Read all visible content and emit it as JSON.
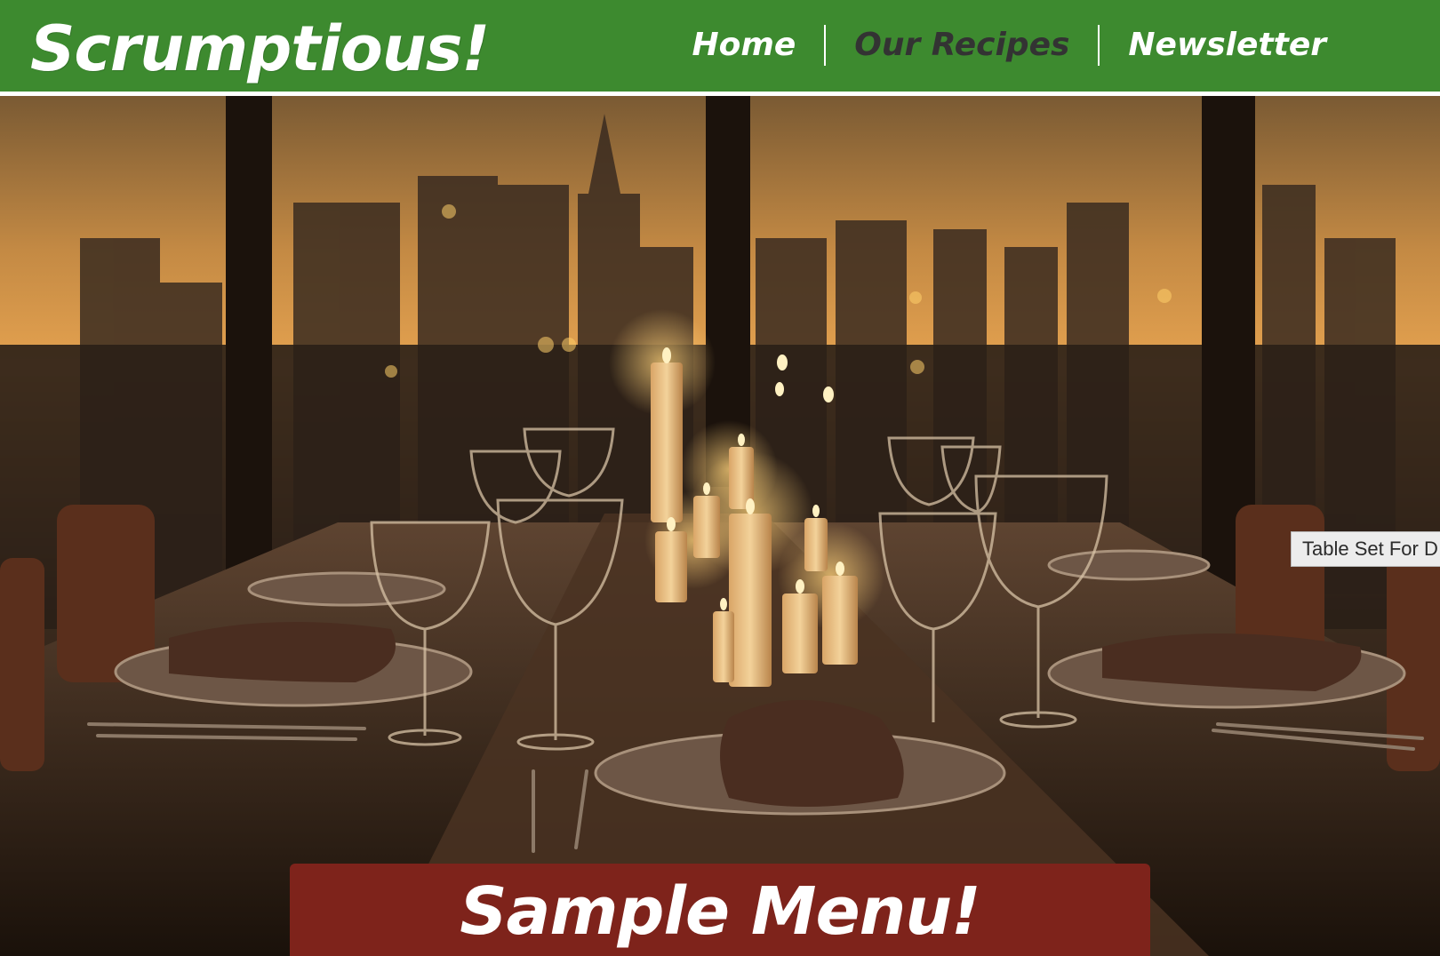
{
  "header": {
    "brand": "Scrumptious!",
    "nav": [
      {
        "label": "Home",
        "active": false
      },
      {
        "label": "Our Recipes",
        "active": true
      },
      {
        "label": "Newsletter",
        "active": false
      }
    ]
  },
  "hero": {
    "image_alt": "Table Set For Dinner",
    "tooltip": "Table Set For D"
  },
  "banner": {
    "title": "Sample Menu!"
  },
  "colors": {
    "header_green": "#3d8a2f",
    "banner_red": "#7e231b",
    "active_nav": "#333333"
  }
}
